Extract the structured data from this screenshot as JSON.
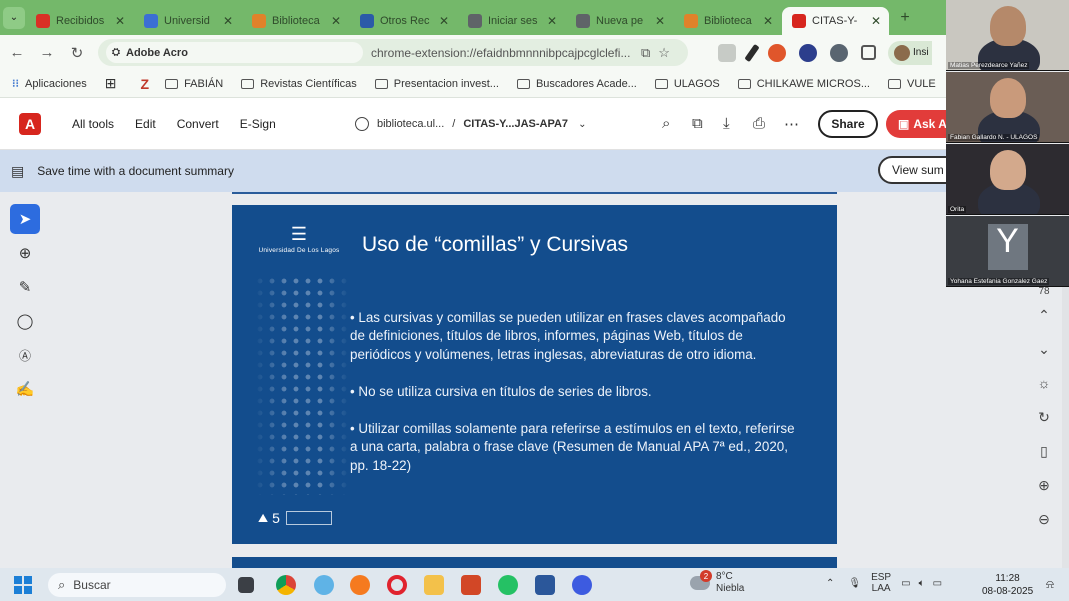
{
  "browser": {
    "tabs": [
      {
        "label": "Recibidos",
        "icon": "gmail-icon",
        "color": "#d93025"
      },
      {
        "label": "Universid",
        "icon": "doc-icon",
        "color": "#3b6fd4"
      },
      {
        "label": "Biblioteca",
        "icon": "library-icon",
        "color": "#e0822a"
      },
      {
        "label": "Otros Rec",
        "icon": "e-icon",
        "color": "#2b5aa8"
      },
      {
        "label": "Iniciar ses",
        "icon": "globe-icon",
        "color": "#5f6368"
      },
      {
        "label": "Nueva pe",
        "icon": "globe-icon",
        "color": "#5f6368"
      },
      {
        "label": "Biblioteca",
        "icon": "library-icon",
        "color": "#e0822a"
      },
      {
        "label": "CITAS-Y-",
        "icon": "pdf-icon",
        "color": "#d7261e"
      }
    ],
    "active_tab_index": 7,
    "site_chip": "Adobe Acro",
    "url": "chrome-extension://efaidnbmnnnibpcajpcglclefi...",
    "profile_label": "Insi"
  },
  "bookmarks": [
    {
      "label": "Aplicaciones",
      "type": "apps"
    },
    {
      "label": "FABIÁN",
      "type": "folder"
    },
    {
      "label": "Revistas Científicas",
      "type": "folder"
    },
    {
      "label": "Presentacion invest...",
      "type": "folder"
    },
    {
      "label": "Buscadores Acade...",
      "type": "folder"
    },
    {
      "label": "ULAGOS",
      "type": "folder"
    },
    {
      "label": "CHILKAWE MICROS...",
      "type": "folder"
    },
    {
      "label": "VULE",
      "type": "folder"
    }
  ],
  "acrobat": {
    "menu": [
      "All tools",
      "Edit",
      "Convert",
      "E-Sign"
    ],
    "doc_site": "biblioteca.ul...",
    "doc_sep": "/",
    "doc_name": "CITAS-Y...JAS-APA7",
    "share_label": "Share",
    "ask_label": "Ask A",
    "banner_text": "Save time with a document summary",
    "view_summary_label": "View sum"
  },
  "slide": {
    "university": "Universidad De Los Lagos",
    "title": "Uso de “comillas” y Cursivas",
    "bullets": [
      "• Las cursivas y comillas se pueden utilizar en frases claves acompañado de definiciones, títulos de libros, informes, páginas Web, títulos de periódicos y volúmenes, letras inglesas, abreviaturas de otro idioma.",
      "• No se utiliza cursiva en títulos de series de libros.",
      "• Utilizar comillas solamente para referirse a estímulos en el texto, referirse a una carta, palabra o frase clave (Resumen de Manual APA 7ª ed., 2020, pp. 18-22)"
    ],
    "footer_mark": "5"
  },
  "viewer": {
    "page_number": "78"
  },
  "participants": [
    {
      "name": "Matias Perezdearce Yañez",
      "skin": "#b5896a",
      "bg": "#c9c7c0"
    },
    {
      "name": "Fabian Gallardo N. - ULAGOS",
      "skin": "#c99a7b",
      "bg": "#6a5d55"
    },
    {
      "name": "Orita",
      "skin": "#d3a98c",
      "bg": "#2d2b30"
    },
    {
      "name": "Yohana Estefania Gonzalez Gaez",
      "initial": "Y"
    }
  ],
  "taskbar": {
    "search_placeholder": "Buscar",
    "weather_temp": "8°C",
    "weather_desc": "Niebla",
    "weather_badge": "2",
    "lang_top": "ESP",
    "lang_bottom": "LAA",
    "time": "11:28",
    "date": "08-08-2025"
  }
}
